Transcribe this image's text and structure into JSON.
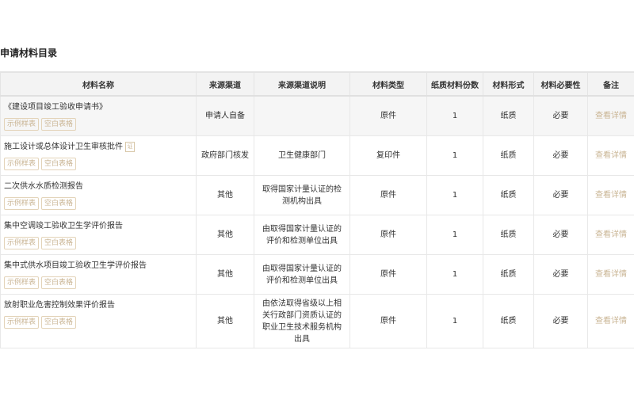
{
  "title": "申请材料目录",
  "headers": [
    "材料名称",
    "来源渠道",
    "来源渠道说明",
    "材料类型",
    "纸质材料份数",
    "材料形式",
    "材料必要性",
    "备注"
  ],
  "tag_sample": "示例样表",
  "tag_blank": "空白表格",
  "detail_label": "查看详情",
  "rows": [
    {
      "name": "《建设项目竣工验收申请书》",
      "source": "申请人自备",
      "source_desc": "",
      "type": "原件",
      "copies": "1",
      "form": "纸质",
      "necessity": "必要"
    },
    {
      "name": "施工设计或总体设计卫生审核批件",
      "source": "政府部门核发",
      "source_desc": "卫生健康部门",
      "type": "复印件",
      "copies": "1",
      "form": "纸质",
      "necessity": "必要",
      "icon": "license-icon"
    },
    {
      "name": "二次供水水质检测报告",
      "source": "其他",
      "source_desc": "取得国家计量认证的检测机构出具",
      "type": "原件",
      "copies": "1",
      "form": "纸质",
      "necessity": "必要"
    },
    {
      "name": "集中空调竣工验收卫生学评价报告",
      "source": "其他",
      "source_desc": "由取得国家计量认证的评价和检测单位出具",
      "type": "原件",
      "copies": "1",
      "form": "纸质",
      "necessity": "必要"
    },
    {
      "name": "集中式供水项目竣工验收卫生学评价报告",
      "source": "其他",
      "source_desc": "由取得国家计量认证的评价和检测单位出具",
      "type": "原件",
      "copies": "1",
      "form": "纸质",
      "necessity": "必要"
    },
    {
      "name": "放射职业危害控制效果评价报告",
      "source": "其他",
      "source_desc": "由依法取得省级以上相关行政部门资质认证的职业卫生技术服务机构出具",
      "type": "原件",
      "copies": "1",
      "form": "纸质",
      "necessity": "必要"
    }
  ]
}
